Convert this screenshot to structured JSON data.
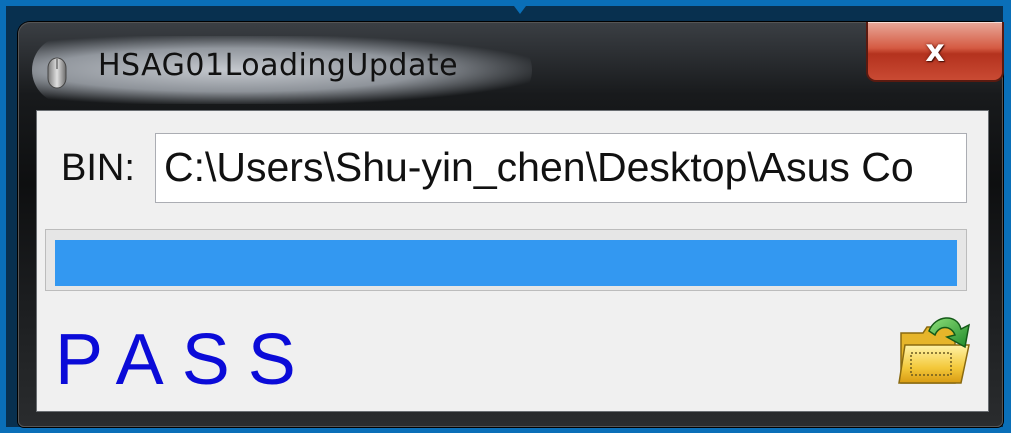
{
  "window": {
    "title": "HSAG01LoadingUpdate",
    "close_label": "x"
  },
  "form": {
    "bin_label": "BIN:",
    "bin_value": "C:\\Users\\Shu-yin_chen\\Desktop\\Asus Co"
  },
  "progress": {
    "percent": 100,
    "color": "#3398f1"
  },
  "status": {
    "text": "PASS",
    "color": "#0b0bd8"
  },
  "icons": {
    "app": "mouse-icon",
    "open_file": "open-folder-icon"
  }
}
